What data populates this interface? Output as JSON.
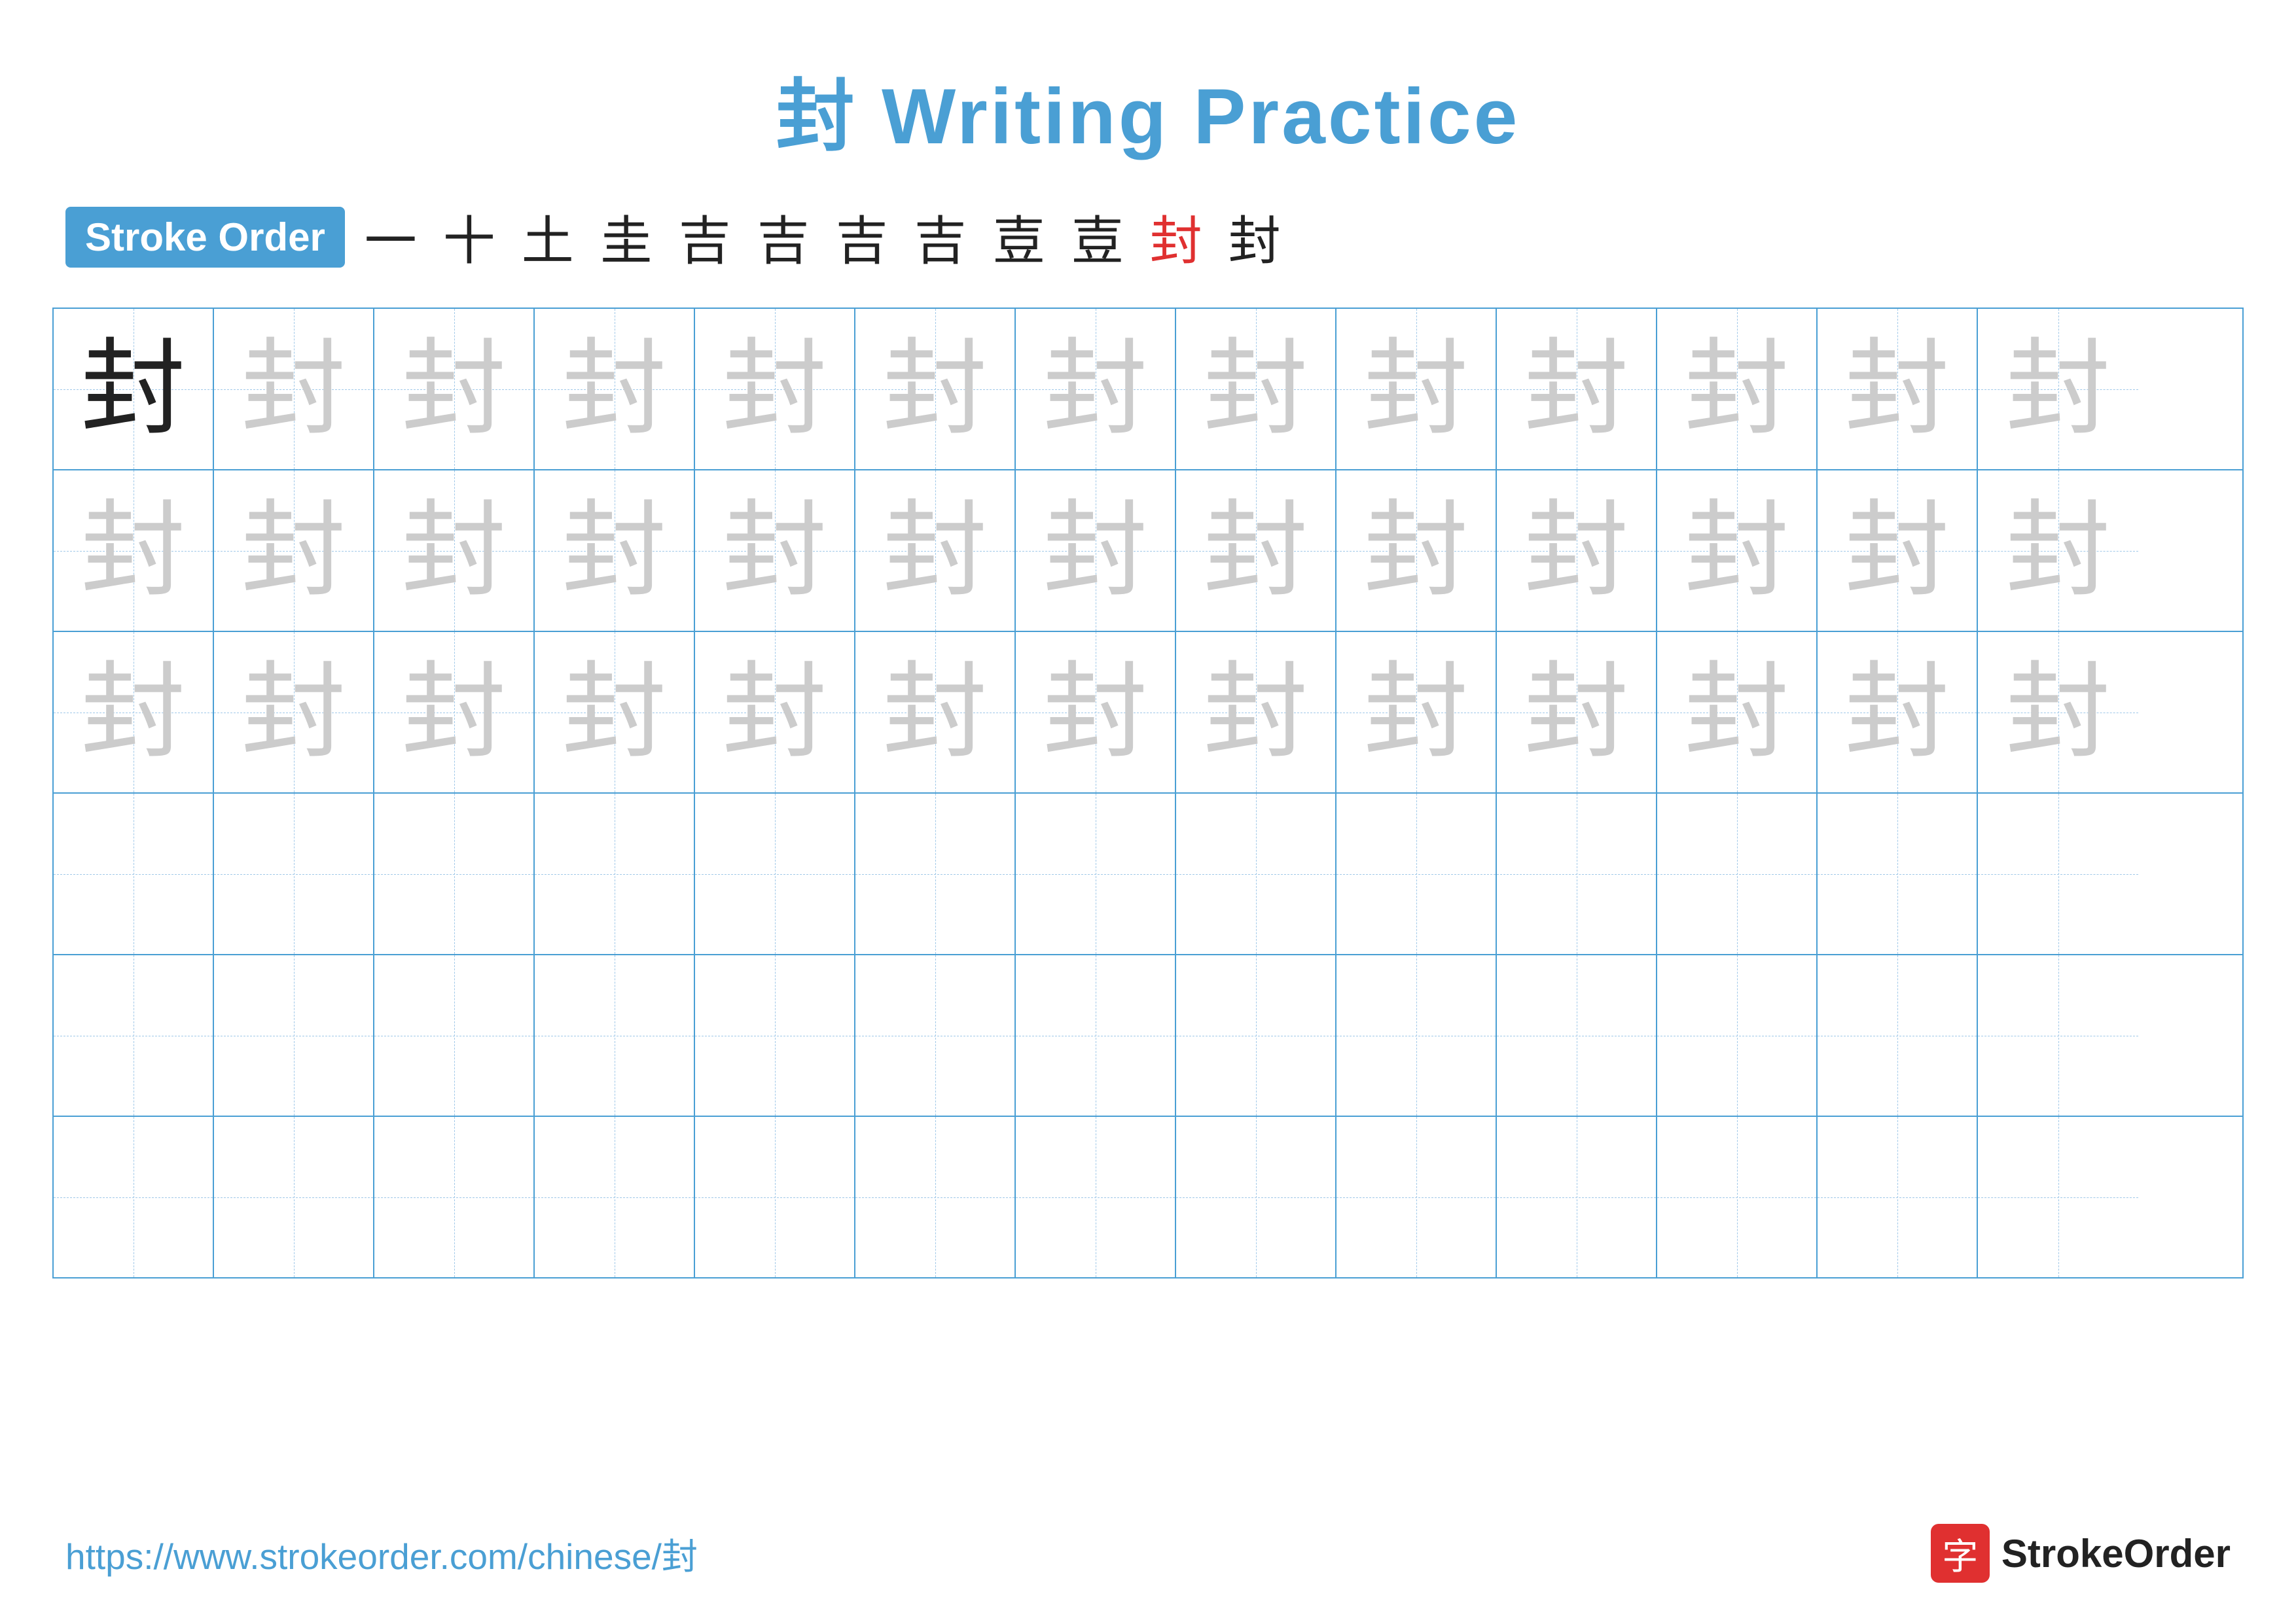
{
  "title": "封 Writing Practice",
  "title_char": "封",
  "title_text": " Writing Practice",
  "stroke_order_badge": "Stroke Order",
  "stroke_steps": [
    {
      "char": "一",
      "red": false
    },
    {
      "char": "十",
      "red": false
    },
    {
      "char": "土",
      "red": false
    },
    {
      "char": "圭",
      "red": false
    },
    {
      "char": "吉",
      "red": false
    },
    {
      "char": "吉",
      "red": false
    },
    {
      "char": "吉",
      "red": false
    },
    {
      "char": "吉",
      "red": false
    },
    {
      "char": "壴",
      "red": false
    },
    {
      "char": "壴",
      "red": false
    },
    {
      "char": "封",
      "red": true
    },
    {
      "char": "封",
      "red": false
    }
  ],
  "grid_rows": 6,
  "grid_cols": 13,
  "practice_char": "封",
  "footer_url": "https://www.strokeorder.com/chinese/封",
  "footer_logo_char": "字",
  "footer_logo_name": "StrokeOrder"
}
